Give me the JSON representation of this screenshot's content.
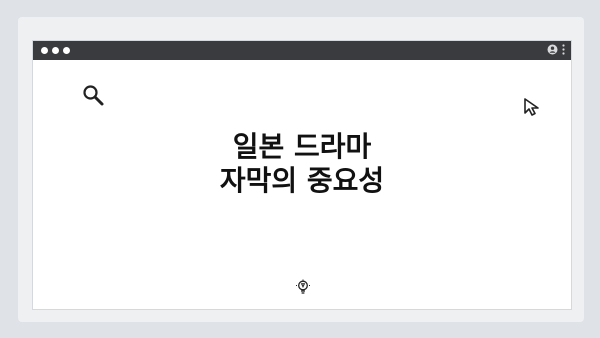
{
  "heading": {
    "line1": "일본 드라마",
    "line2": "자막의 중요성"
  },
  "icons": {
    "window_controls": "traffic-light-dots",
    "top_right": [
      "user-icon",
      "more-vertical-icon"
    ],
    "decor": [
      "search-icon",
      "cursor-icon",
      "lightbulb-icon"
    ]
  },
  "colors": {
    "background": "#dfe3e8",
    "titlebar": "#3a3b3e",
    "window": "#ffffff",
    "text": "#111111"
  }
}
